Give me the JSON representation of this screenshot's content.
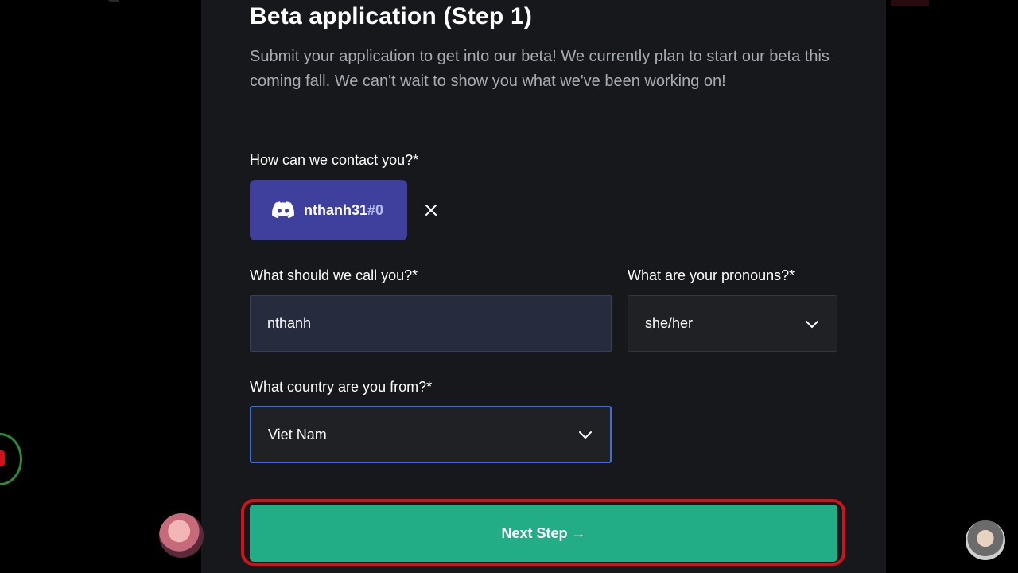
{
  "form": {
    "title": "Beta application (Step 1)",
    "description": "Submit your application to get into our beta! We currently plan to start our beta this coming fall. We can't wait to show you what we've been working on!",
    "contact": {
      "label": "How can we contact you?*",
      "username": "nthanh31",
      "discriminator": "#0",
      "icon": "discord-icon",
      "remove_icon": "close-icon"
    },
    "name": {
      "label": "What should we call you?*",
      "value": "nthanh"
    },
    "pronouns": {
      "label": "What are your pronouns?*",
      "value": "she/her"
    },
    "country": {
      "label": "What country are you from?*",
      "value": "Viet Nam"
    },
    "next_button": "Next Step →"
  },
  "colors": {
    "page_bg": "#000000",
    "panel_bg": "#17181b",
    "discord_chip": "#3f3f9e",
    "input_bg": "#262c3d",
    "focus_border": "#3b6fe0",
    "primary_button": "#22ad87",
    "highlight_ring": "#d0121b"
  }
}
